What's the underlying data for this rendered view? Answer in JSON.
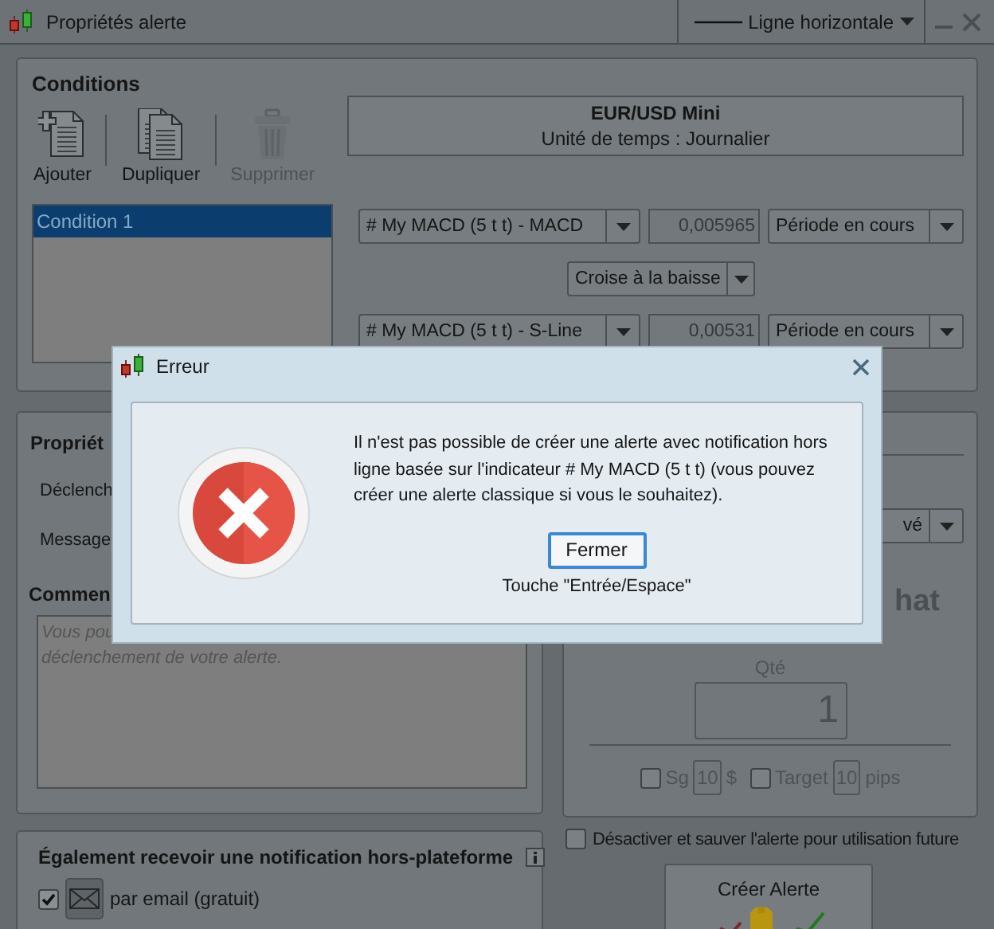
{
  "window": {
    "title": "Propriétés alerte",
    "drawing_tool": "Ligne horizontale"
  },
  "conditions": {
    "title": "Conditions",
    "toolbar": [
      {
        "label": "Ajouter",
        "kind": "add",
        "disabled": false
      },
      {
        "label": "Dupliquer",
        "kind": "duplicate",
        "disabled": false
      },
      {
        "label": "Supprimer",
        "kind": "delete",
        "disabled": true
      }
    ],
    "instrument": {
      "name": "EUR/USD Mini",
      "timeframe": "Unité de temps : Journalier"
    },
    "list": [
      {
        "label": "Condition 1",
        "selected": true
      }
    ],
    "rows": [
      {
        "indicator": "# My MACD (5 t t) - MACD",
        "value": "0,005965",
        "period": "Période en cours"
      },
      {
        "indicator": "# My MACD (5 t t) - S-Line",
        "value": "0,00531",
        "period": "Période en cours"
      }
    ],
    "operator": "Croise à la baisse"
  },
  "properties": {
    "title": "Propriét",
    "trigger_label": "Déclench",
    "message_label": "Message"
  },
  "comment": {
    "title": "Commen",
    "placeholder": "Vous pou\ndéclenchement de votre alerte."
  },
  "order": {
    "dropdown": "vé",
    "title": "hat",
    "qty_label": "Qté",
    "qty": "1",
    "options": [
      {
        "label": "Sg",
        "checked": false,
        "value": "10",
        "unit": "$"
      },
      {
        "label": "Target",
        "checked": false,
        "value": "10",
        "unit": "pips"
      }
    ]
  },
  "deactivate": {
    "label": "Désactiver et sauver l'alerte pour utilisation future",
    "checked": false
  },
  "notifications": {
    "title": "Également recevoir une notification hors-plateforme",
    "items": [
      {
        "label": "par email (gratuit)",
        "checked": true,
        "kind": "email"
      }
    ]
  },
  "create_button": {
    "label": "Créer Alerte"
  },
  "dialog": {
    "title": "Erreur",
    "message": "Il n'est pas possible de créer une alerte avec notification hors ligne basée sur l'indicateur # My MACD (5 t t) (vous pouvez créer une alerte classique si vous le souhaitez).",
    "button": "Fermer",
    "hint": "Touche \"Entrée/Espace\""
  }
}
